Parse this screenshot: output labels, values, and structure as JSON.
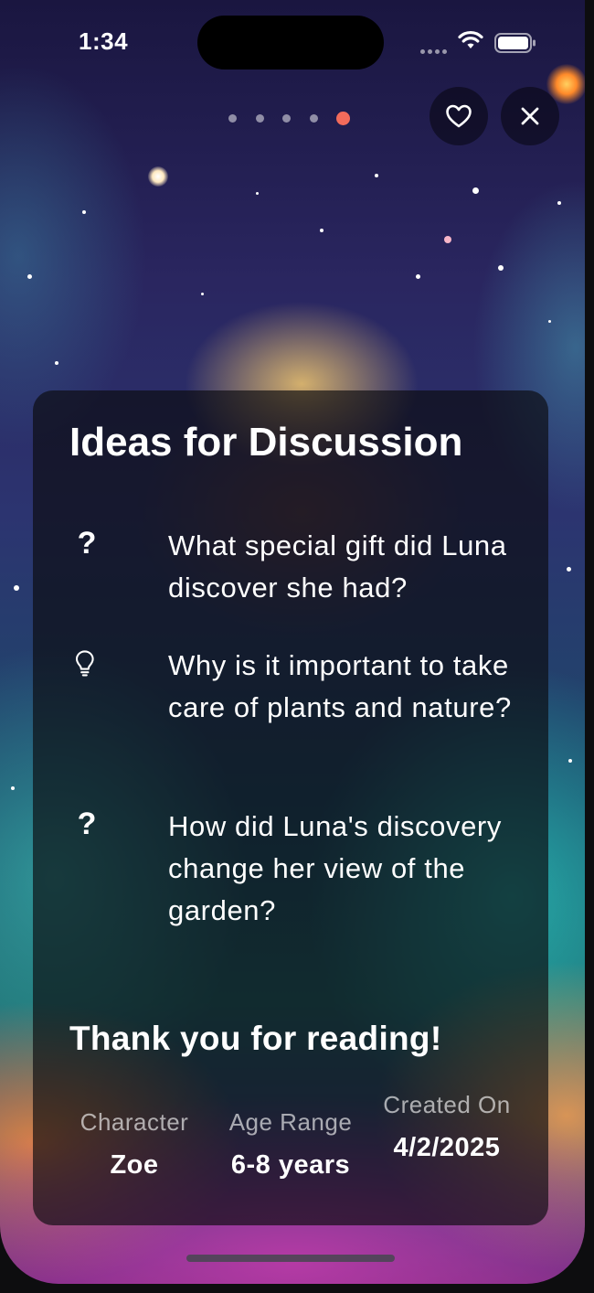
{
  "status_bar": {
    "time": "1:34"
  },
  "pager": {
    "total": 5,
    "active_index": 4
  },
  "header": {
    "favorite_icon": "heart-icon",
    "close_icon": "close-icon"
  },
  "card": {
    "title": "Ideas for Discussion",
    "questions": [
      {
        "icon": "question-mark-icon",
        "text": "What special gift did Luna discover she had?"
      },
      {
        "icon": "lightbulb-icon",
        "text": "Why is it important to take care of plants and nature?"
      },
      {
        "icon": "question-mark-icon",
        "text": "How did Luna's discovery change her view of the garden?"
      }
    ],
    "thanks": "Thank you for reading!",
    "meta": [
      {
        "label": "Character",
        "value": "Zoe"
      },
      {
        "label": "Age Range",
        "value": "6-8 years"
      },
      {
        "label": "Created On",
        "value": "4/2/2025"
      }
    ]
  },
  "colors": {
    "accent": "#f26b5b",
    "card_bg": "rgba(10,10,14,0.66)"
  }
}
